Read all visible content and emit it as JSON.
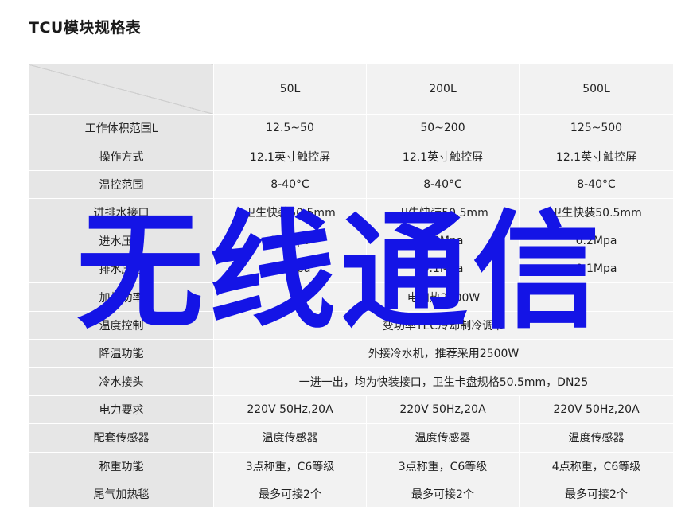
{
  "page": {
    "title": "TCU模块规格表"
  },
  "table": {
    "columns": [
      "50L",
      "200L",
      "500L"
    ],
    "rows": [
      {
        "label": "工作体积范围L",
        "cells": [
          "12.5~50",
          "50~200",
          "125~500"
        ]
      },
      {
        "label": "操作方式",
        "cells": [
          "12.1英寸触控屏",
          "12.1英寸触控屏",
          "12.1英寸触控屏"
        ]
      },
      {
        "label": "温控范围",
        "cells": [
          "8-40°C",
          "8-40°C",
          "8-40°C"
        ]
      },
      {
        "label": "进排水接口",
        "cells": [
          "卫生快装50.5mm",
          "卫生快装50.5mm",
          "卫生快装50.5mm"
        ]
      },
      {
        "label": "进水压力",
        "cells": [
          "0.2Mpa",
          "0.2Mpa",
          "0.2Mpa"
        ]
      },
      {
        "label": "排水压力",
        "cells": [
          "0.1Mpa",
          "0.1Mpa",
          "0.1Mpa"
        ]
      },
      {
        "label": "加热功率",
        "merged": "电加热2000W"
      },
      {
        "label": "温度控制",
        "merged": "变功率TEC冷却制冷调节"
      },
      {
        "label": "降温功能",
        "merged": "外接冷水机，推荐采用2500W"
      },
      {
        "label": "冷水接头",
        "merged": "一进一出，均为快装接口，卫生卡盘规格50.5mm，DN25"
      },
      {
        "label": "电力要求",
        "cells": [
          "220V 50Hz,20A",
          "220V 50Hz,20A",
          "220V 50Hz,20A"
        ]
      },
      {
        "label": "配套传感器",
        "cells": [
          "温度传感器",
          "温度传感器",
          "温度传感器"
        ]
      },
      {
        "label": "称重功能",
        "cells": [
          "3点称重，C6等级",
          "3点称重，C6等级",
          "4点称重，C6等级"
        ]
      },
      {
        "label": "尾气加热毯",
        "cells": [
          "最多可接2个",
          "最多可接2个",
          "最多可接2个"
        ]
      }
    ]
  },
  "watermark": {
    "text": "无线通信",
    "color": "#1414e6"
  }
}
